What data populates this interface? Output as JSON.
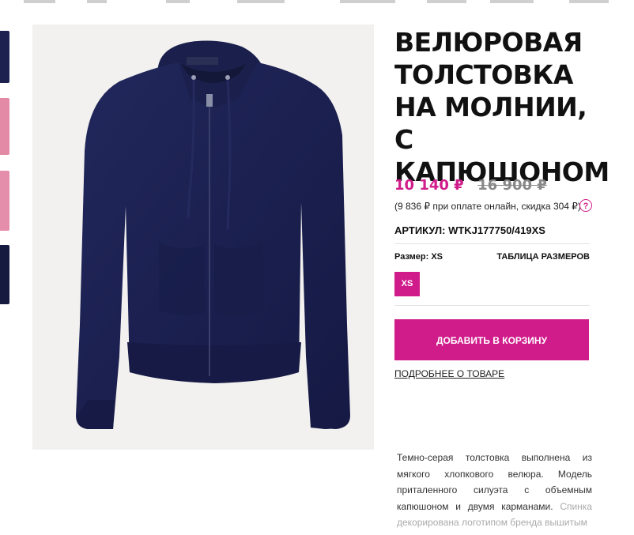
{
  "product": {
    "title": "ВЕЛЮРОВАЯ ТОЛСТОВКА НА МОЛНИИ, С КАПЮШОНОМ",
    "price_current": "10 140 ₽",
    "price_old": "16 900 ₽",
    "online_note": "(9 836 ₽ при оплате онлайн, скидка 304 ₽)",
    "help_symbol": "?",
    "sku": "АРТИКУЛ: WTKJ177750/419XS",
    "size_label": "Размер: XS",
    "size_chart_link": "ТАБЛИЦА РАЗМЕРОВ",
    "size_option": "XS",
    "add_to_cart": "ДОБАВИТЬ В КОРЗИНУ",
    "details_link": "ПОДРОБНЕЕ О ТОВАРЕ",
    "description": "Темно-серая толстовка выполнена из мягкого хлопкового велюра. Модель приталенного силуэта с объемным капюшоном и двумя карманами.",
    "description_faded": "Спинка декорирована логотипом бренда вышитым"
  },
  "colors": {
    "accent": "#d01c8b",
    "garment": "#1c2150",
    "photo_bg": "#f2f1ef"
  },
  "thumbnails": [
    "navy",
    "pink",
    "pink",
    "navy"
  ]
}
